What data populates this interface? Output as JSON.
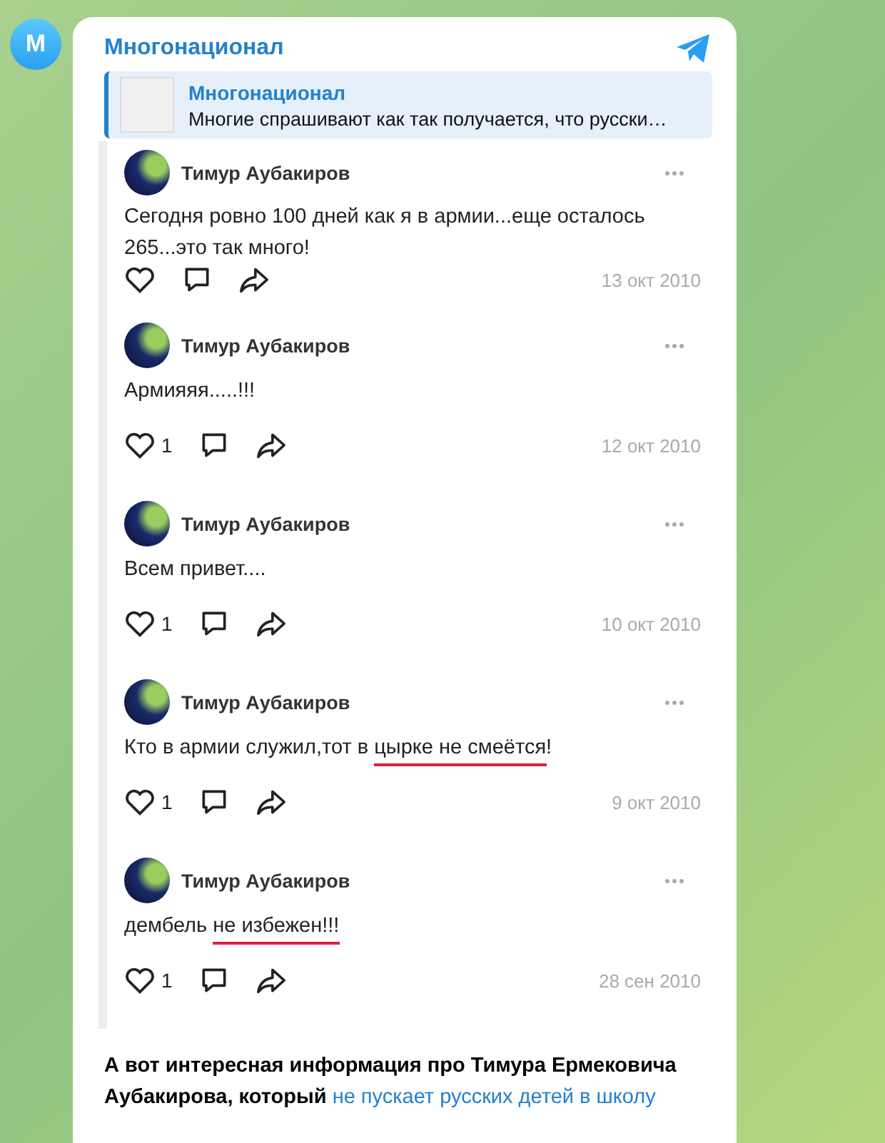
{
  "channel": {
    "avatar_letter": "M",
    "name": "Многонационал"
  },
  "reply": {
    "title": "Многонационал",
    "text": "Многие спрашивают как так получается, что русски…"
  },
  "posts": [
    {
      "author": "Тимур Аубакиров",
      "segments": [
        {
          "text": "Сегодня ровно 100 дней как я в армии...еще осталось 265...это так много!",
          "underlined": false
        }
      ],
      "date": "13 окт 2010"
    },
    {
      "author": "Тимур Аубакиров",
      "segments": [
        {
          "text": "Армияяя.....!!!",
          "underlined": false
        }
      ],
      "likes": "1",
      "date": "12 окт 2010"
    },
    {
      "author": "Тимур Аубакиров",
      "segments": [
        {
          "text": "Всем привет....",
          "underlined": false
        }
      ],
      "likes": "1",
      "date": "10 окт 2010"
    },
    {
      "author": "Тимур Аубакиров",
      "segments": [
        {
          "text": "Кто в армии служил,тот в ",
          "underlined": false
        },
        {
          "text": "цырке не смеётся",
          "underlined": true
        },
        {
          "text": "!",
          "underlined": false
        }
      ],
      "likes": "1",
      "date": "9 окт 2010"
    },
    {
      "author": "Тимур Аубакиров",
      "segments": [
        {
          "text": "дембель ",
          "underlined": false
        },
        {
          "text": "не избежен!!!",
          "underlined": true
        }
      ],
      "likes": "1",
      "date": "28 сен 2010"
    }
  ],
  "caption": {
    "text": "А вот интересная информация про Тимура Ермековича Аубакирова, который ",
    "link": "не пускает русских детей в школу"
  }
}
